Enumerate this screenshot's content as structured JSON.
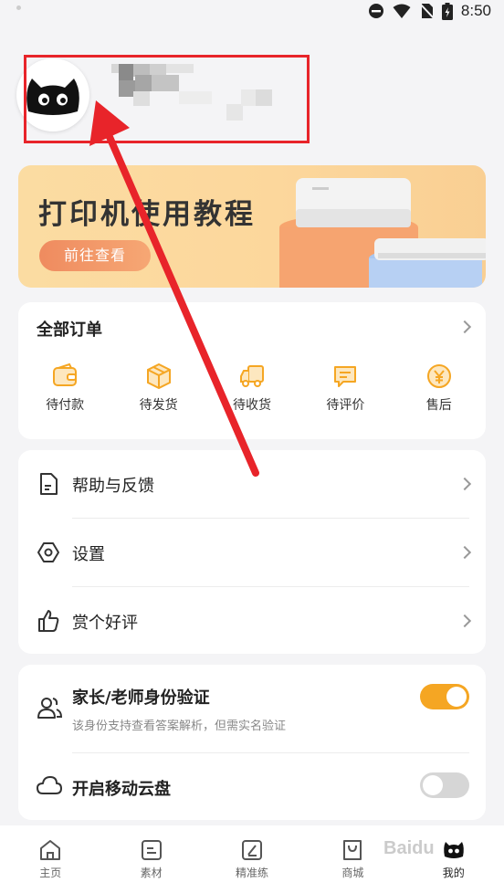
{
  "status_bar": {
    "time": "8:50"
  },
  "banner": {
    "title": "打印机使用教程",
    "button_label": "前往查看"
  },
  "orders": {
    "title": "全部订单",
    "items": [
      {
        "label": "待付款",
        "icon": "wallet-icon"
      },
      {
        "label": "待发货",
        "icon": "box-icon"
      },
      {
        "label": "待收货",
        "icon": "truck-icon"
      },
      {
        "label": "待评价",
        "icon": "comment-icon"
      },
      {
        "label": "售后",
        "icon": "yuan-refund-icon"
      }
    ]
  },
  "menu": {
    "items": [
      {
        "label": "帮助与反馈",
        "icon": "document-icon"
      },
      {
        "label": "设置",
        "icon": "settings-icon"
      },
      {
        "label": "赏个好评",
        "icon": "thumbs-up-icon"
      }
    ]
  },
  "verify": {
    "title": "家长/老师身份验证",
    "subtitle": "该身份支持查看答案解析，但需实名验证",
    "toggle_on": true,
    "cloud_label": "开启移动云盘",
    "cloud_toggle_on": false
  },
  "tabbar": {
    "items": [
      {
        "label": "主页",
        "icon": "home-icon"
      },
      {
        "label": "素材",
        "icon": "material-icon"
      },
      {
        "label": "精准练",
        "icon": "practice-icon"
      },
      {
        "label": "商城",
        "icon": "shop-bag-icon"
      },
      {
        "label": "我的",
        "icon": "cat-avatar-icon"
      }
    ]
  },
  "watermark": "Baidu",
  "colors": {
    "accent": "#f5a623",
    "annotation_red": "#e8242a",
    "toggle_on": "#f5a623",
    "toggle_off": "#d6d6d6"
  }
}
